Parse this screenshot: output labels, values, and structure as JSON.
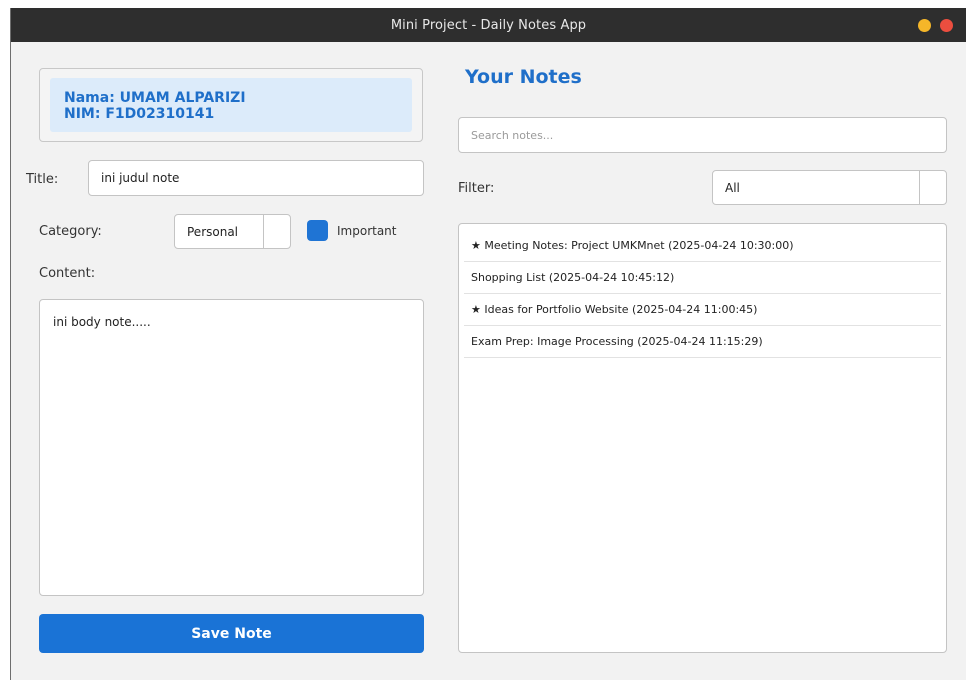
{
  "window": {
    "title": "Mini Project - Daily Notes App"
  },
  "student": {
    "name": "Nama: UMAM ALPARIZI",
    "nim": "NIM: F1D02310141"
  },
  "form": {
    "title_label": "Title:",
    "title_value": "ini judul note",
    "category_label": "Category:",
    "category_value": "Personal",
    "important_label": "Important",
    "content_label": "Content:",
    "content_value": "ini body note.....",
    "save_label": "Save Note"
  },
  "notes": {
    "heading": "Your Notes",
    "search_placeholder": "Search notes...",
    "filter_label": "Filter:",
    "filter_value": "All",
    "items": [
      "★ Meeting Notes: Project UMKMnet (2025-04-24 10:30:00)",
      "Shopping List (2025-04-24 10:45:12)",
      "★ Ideas for Portfolio Website (2025-04-24 11:00:45)",
      "Exam Prep: Image Processing (2025-04-24 11:15:29)"
    ]
  },
  "colors": {
    "accent": "#1a73d6",
    "heading": "#1f6fc9",
    "info_bg": "#dcebfa",
    "minimize": "#f5b629",
    "close": "#ec4e3f"
  },
  "icons": {
    "minimize": "minimize-icon",
    "close": "close-icon",
    "combo_arrow": "chevron-down-icon"
  }
}
